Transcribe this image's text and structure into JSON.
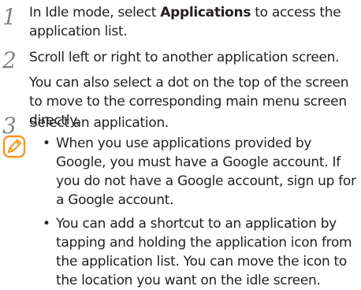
{
  "steps": [
    {
      "number": "1",
      "before": "In Idle mode, select ",
      "bold": "Applications",
      "after": " to access the application list."
    },
    {
      "number": "2",
      "text": "Scroll left or right to another application screen.",
      "text2": "You can also select a dot on the top of the screen to move to the corresponding main menu screen directly."
    },
    {
      "number": "3",
      "text": "Select an application."
    }
  ],
  "note": {
    "icon": "note-pencil-icon",
    "icon_color": "#f7941d",
    "bullet": "•",
    "items": [
      "When you use applications provided by Google, you must have a Google account. If you do not have a Google account, sign up for a Google account.",
      "You can add a shortcut to an application by tapping and holding the application icon from the application list. You can move the icon to the location you want on the idle screen."
    ]
  }
}
